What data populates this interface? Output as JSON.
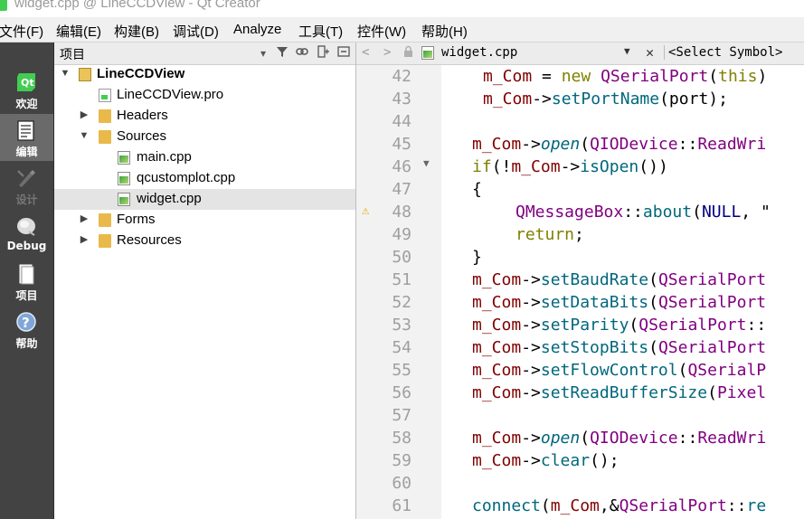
{
  "window": {
    "title": "widget.cpp @ LineCCDView - Qt Creator"
  },
  "menu": [
    "文件(F)",
    "编辑(E)",
    "构建(B)",
    "调试(D)",
    "Analyze",
    "工具(T)",
    "控件(W)",
    "帮助(H)"
  ],
  "modes": [
    {
      "label": "欢迎",
      "icon": "qt-logo-icon",
      "state": "normal"
    },
    {
      "label": "编辑",
      "icon": "edit-document-icon",
      "state": "active"
    },
    {
      "label": "设计",
      "icon": "design-pencil-icon",
      "state": "disabled"
    },
    {
      "label": "Debug",
      "icon": "debug-bug-icon",
      "state": "normal"
    },
    {
      "label": "项目",
      "icon": "projects-icon",
      "state": "normal"
    },
    {
      "label": "帮助",
      "icon": "help-question-icon",
      "state": "normal"
    }
  ],
  "project_panel": {
    "title": "项目",
    "tree": [
      {
        "label": "LineCCDView",
        "level": 0,
        "expanded": true,
        "icon": "project-root-icon",
        "bold": true
      },
      {
        "label": "LineCCDView.pro",
        "level": 1,
        "icon": "pro-file-icon"
      },
      {
        "label": "Headers",
        "level": 1,
        "expanded": false,
        "icon": "headers-folder-icon"
      },
      {
        "label": "Sources",
        "level": 1,
        "expanded": true,
        "icon": "sources-folder-icon"
      },
      {
        "label": "main.cpp",
        "level": 2,
        "icon": "cpp-file-icon"
      },
      {
        "label": "qcustomplot.cpp",
        "level": 2,
        "icon": "cpp-file-icon"
      },
      {
        "label": "widget.cpp",
        "level": 2,
        "icon": "cpp-file-icon",
        "selected": true
      },
      {
        "label": "Forms",
        "level": 1,
        "expanded": false,
        "icon": "forms-folder-icon"
      },
      {
        "label": "Resources",
        "level": 1,
        "expanded": false,
        "icon": "resources-folder-icon"
      }
    ]
  },
  "editor": {
    "file_name": "widget.cpp",
    "symbol_placeholder": "<Select Symbol>",
    "lines": [
      {
        "n": "42",
        "indent": 1,
        "tokens": [
          [
            "var",
            "m_Com"
          ],
          [
            "plain",
            " = "
          ],
          [
            "kw",
            "new"
          ],
          [
            "plain",
            " "
          ],
          [
            "type",
            "QSerialPort"
          ],
          [
            "plain",
            "("
          ],
          [
            "kw",
            "this"
          ],
          [
            "plain",
            ")"
          ]
        ]
      },
      {
        "n": "43",
        "indent": 1,
        "tokens": [
          [
            "var",
            "m_Com"
          ],
          [
            "plain",
            "->"
          ],
          [
            "fn",
            "setPortName"
          ],
          [
            "plain",
            "(port);"
          ]
        ]
      },
      {
        "n": "44",
        "indent": 0,
        "tokens": []
      },
      {
        "n": "45",
        "indent": 0,
        "tokens": [
          [
            "var",
            "m_Com"
          ],
          [
            "plain",
            "->"
          ],
          [
            "fni",
            "open"
          ],
          [
            "plain",
            "("
          ],
          [
            "type",
            "QIODevice"
          ],
          [
            "plain",
            "::"
          ],
          [
            "type",
            "ReadWri"
          ]
        ]
      },
      {
        "n": "46",
        "indent": 0,
        "fold": true,
        "tokens": [
          [
            "kw",
            "if"
          ],
          [
            "plain",
            "(!"
          ],
          [
            "var",
            "m_Com"
          ],
          [
            "plain",
            "->"
          ],
          [
            "fn",
            "isOpen"
          ],
          [
            "plain",
            "())"
          ]
        ]
      },
      {
        "n": "47",
        "indent": 0,
        "tokens": [
          [
            "plain",
            "{"
          ]
        ]
      },
      {
        "n": "48",
        "indent": 2,
        "warn": true,
        "tokens": [
          [
            "type",
            "QMessageBox"
          ],
          [
            "plain",
            "::"
          ],
          [
            "fn",
            "about"
          ],
          [
            "plain",
            "("
          ],
          [
            "mac",
            "NULL"
          ],
          [
            "plain",
            ", \""
          ]
        ]
      },
      {
        "n": "49",
        "indent": 2,
        "tokens": [
          [
            "kw",
            "return"
          ],
          [
            "plain",
            ";"
          ]
        ]
      },
      {
        "n": "50",
        "indent": 0,
        "tokens": [
          [
            "plain",
            "}"
          ]
        ]
      },
      {
        "n": "51",
        "indent": 0,
        "tokens": [
          [
            "var",
            "m_Com"
          ],
          [
            "plain",
            "->"
          ],
          [
            "fn",
            "setBaudRate"
          ],
          [
            "plain",
            "("
          ],
          [
            "type",
            "QSerialPort"
          ]
        ]
      },
      {
        "n": "52",
        "indent": 0,
        "tokens": [
          [
            "var",
            "m_Com"
          ],
          [
            "plain",
            "->"
          ],
          [
            "fn",
            "setDataBits"
          ],
          [
            "plain",
            "("
          ],
          [
            "type",
            "QSerialPort"
          ]
        ]
      },
      {
        "n": "53",
        "indent": 0,
        "tokens": [
          [
            "var",
            "m_Com"
          ],
          [
            "plain",
            "->"
          ],
          [
            "fn",
            "setParity"
          ],
          [
            "plain",
            "("
          ],
          [
            "type",
            "QSerialPort"
          ],
          [
            "plain",
            "::"
          ]
        ]
      },
      {
        "n": "54",
        "indent": 0,
        "tokens": [
          [
            "var",
            "m_Com"
          ],
          [
            "plain",
            "->"
          ],
          [
            "fn",
            "setStopBits"
          ],
          [
            "plain",
            "("
          ],
          [
            "type",
            "QSerialPort"
          ]
        ]
      },
      {
        "n": "55",
        "indent": 0,
        "tokens": [
          [
            "var",
            "m_Com"
          ],
          [
            "plain",
            "->"
          ],
          [
            "fn",
            "setFlowControl"
          ],
          [
            "plain",
            "("
          ],
          [
            "type",
            "QSerialP"
          ]
        ]
      },
      {
        "n": "56",
        "indent": 0,
        "tokens": [
          [
            "var",
            "m_Com"
          ],
          [
            "plain",
            "->"
          ],
          [
            "fn",
            "setReadBufferSize"
          ],
          [
            "plain",
            "("
          ],
          [
            "type",
            "Pixel"
          ]
        ]
      },
      {
        "n": "57",
        "indent": 0,
        "tokens": []
      },
      {
        "n": "58",
        "indent": 0,
        "tokens": [
          [
            "var",
            "m_Com"
          ],
          [
            "plain",
            "->"
          ],
          [
            "fni",
            "open"
          ],
          [
            "plain",
            "("
          ],
          [
            "type",
            "QIODevice"
          ],
          [
            "plain",
            "::"
          ],
          [
            "type",
            "ReadWri"
          ]
        ]
      },
      {
        "n": "59",
        "indent": 0,
        "tokens": [
          [
            "var",
            "m_Com"
          ],
          [
            "plain",
            "->"
          ],
          [
            "fn",
            "clear"
          ],
          [
            "plain",
            "();"
          ]
        ]
      },
      {
        "n": "60",
        "indent": 0,
        "tokens": []
      },
      {
        "n": "61",
        "indent": 0,
        "tokens": [
          [
            "fn",
            "connect"
          ],
          [
            "plain",
            "("
          ],
          [
            "var",
            "m_Com"
          ],
          [
            "plain",
            ",&"
          ],
          [
            "type",
            "QSerialPort"
          ],
          [
            "plain",
            "::"
          ],
          [
            "fn",
            "re"
          ]
        ]
      }
    ]
  },
  "colors": {
    "mode_bar": "#434343",
    "mode_active": "#6a6a6a",
    "gutter": "#f2f2f2",
    "selection": "#e4e4e4",
    "qt_green": "#41cd52"
  }
}
